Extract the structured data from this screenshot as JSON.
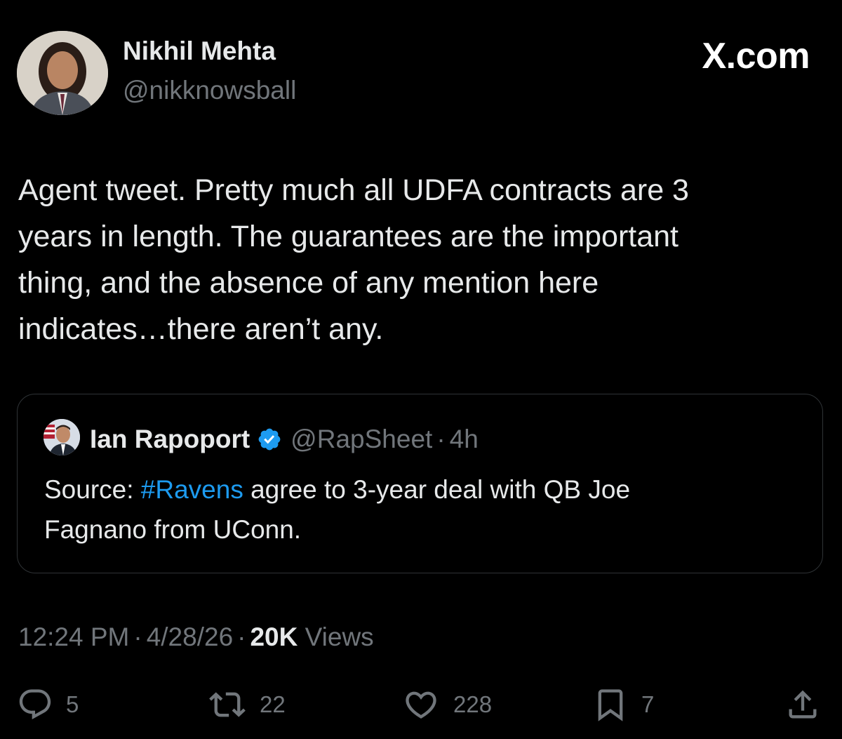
{
  "author": {
    "name": "Nikhil Mehta",
    "handle": "@nikknowsball"
  },
  "brand": "X.com",
  "tweet": {
    "lines": [
      "Agent tweet. Pretty much all UDFA contracts are 3",
      "years in length. The guarantees are the important",
      "thing, and the absence of any mention here",
      "indicates…there aren’t any."
    ]
  },
  "quoted": {
    "name": "Ian Rapoport",
    "handle": "@RapSheet",
    "separator": "·",
    "time": "4h",
    "text_before": "Source: ",
    "hashtag": "#Ravens",
    "text_line1_after": " agree to 3-year deal with QB Joe",
    "text_line2": "Fagnano from UConn."
  },
  "meta": {
    "time": "12:24 PM",
    "separator": "·",
    "date": "4/28/26",
    "views_count": "20K",
    "views_label": "Views"
  },
  "actions": {
    "replies": "5",
    "reposts": "22",
    "likes": "228",
    "bookmarks": "7"
  },
  "icons": {
    "reply": "reply-icon",
    "repost": "repost-icon",
    "like": "heart-icon",
    "bookmark": "bookmark-icon",
    "share": "share-icon",
    "verified": "verified-badge-icon"
  },
  "colors": {
    "background": "#000000",
    "text": "#e7e9ea",
    "secondary": "#71767b",
    "accent": "#1d9bf0",
    "border": "#2f3336"
  }
}
